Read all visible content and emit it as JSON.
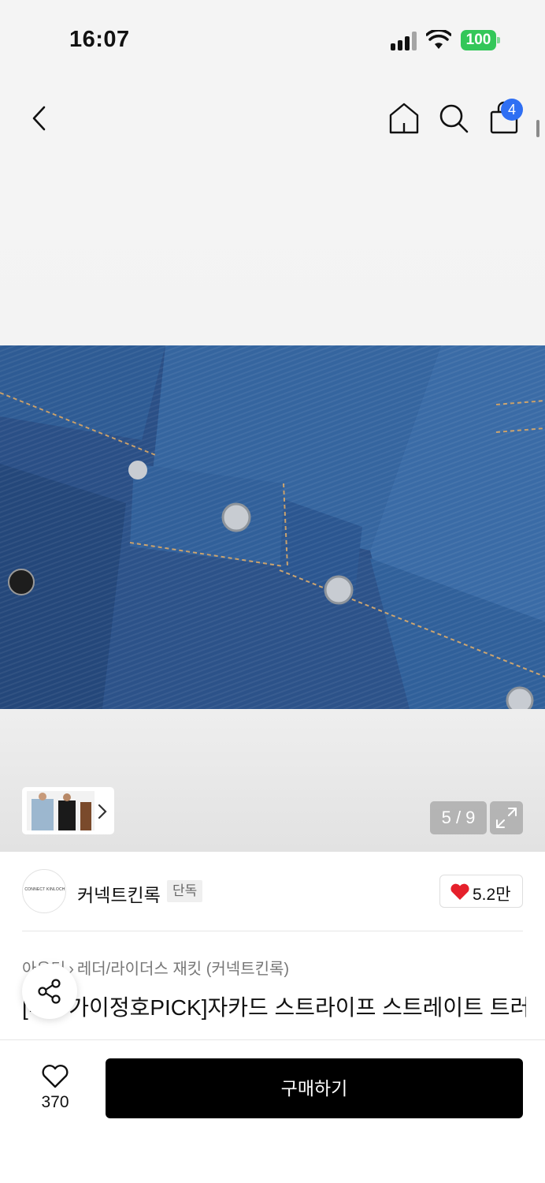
{
  "status_bar": {
    "time": "16:07",
    "battery": "100",
    "icons": [
      "signal-icon",
      "wifi-icon",
      "battery-icon"
    ]
  },
  "nav": {
    "icons": [
      "back-icon",
      "home-icon",
      "search-icon",
      "cart-icon"
    ],
    "cart_badge": "4"
  },
  "gallery": {
    "counter": "5 / 9",
    "icons": [
      "chevron-right-icon",
      "expand-icon"
    ]
  },
  "brand": {
    "logo_text": "CONNECT KINLOCH",
    "name": "커넥트킨록",
    "badge": "단독",
    "likes": "5.2만"
  },
  "breadcrumb": {
    "category": "아우터",
    "subcategory": "레더/라이더스 재킷 (커넥트킨록)"
  },
  "product": {
    "title": "[배우가이정호PICK]자카드 스트라이프 스트레이트 트러커 [블루]"
  },
  "bottom_bar": {
    "wish_count": "370",
    "buy_label": "구매하기"
  },
  "colors": {
    "accent": "#2f6ff3",
    "heart": "#e5202b",
    "battery": "#33c759",
    "buy_button": "#000000"
  }
}
